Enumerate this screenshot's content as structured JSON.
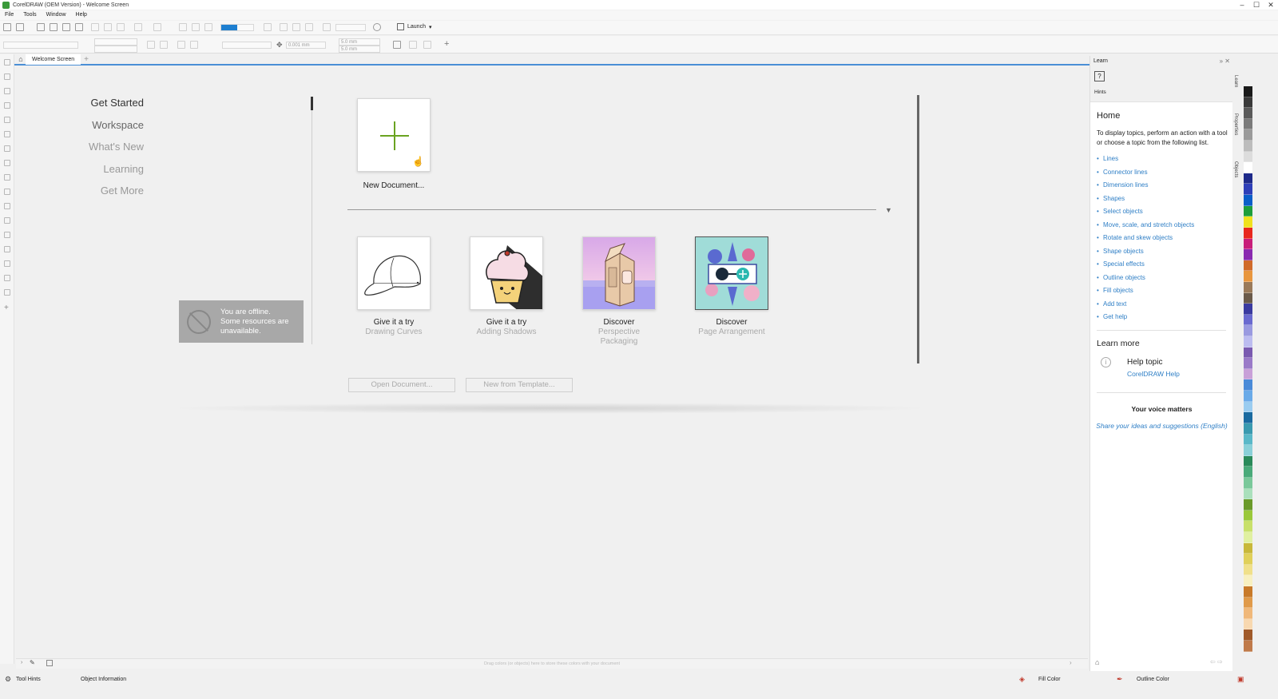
{
  "window": {
    "title": "CorelDRAW (OEM Version) - Welcome Screen",
    "controls": [
      "minimize",
      "maximize",
      "close"
    ]
  },
  "menu": [
    "File",
    "Tools",
    "Window",
    "Help"
  ],
  "toolbar": {
    "launch_label": "Launch",
    "nudge_value": "0.001 mm",
    "duplicate_x": "5.0 mm",
    "duplicate_y": "5.0 mm"
  },
  "tabs": {
    "welcome": "Welcome Screen",
    "add": "+"
  },
  "nav": [
    {
      "label": "Get Started",
      "state": "active"
    },
    {
      "label": "Workspace",
      "state": "dim"
    },
    {
      "label": "What's New",
      "state": "muted"
    },
    {
      "label": "Learning",
      "state": "muted"
    },
    {
      "label": "Get More",
      "state": "muted"
    }
  ],
  "offline": {
    "line1": "You are offline.",
    "line2": "Some resources are",
    "line3": "unavailable."
  },
  "new_document": {
    "label": "New Document..."
  },
  "cards": [
    {
      "title": "Give it a try",
      "subtitle": "Drawing Curves",
      "subtitle2": "",
      "image": "baseball-cap-icon"
    },
    {
      "title": "Give it a try",
      "subtitle": "Adding Shadows",
      "subtitle2": "",
      "image": "cupcake-icon"
    },
    {
      "title": "Discover",
      "subtitle": "Perspective",
      "subtitle2": "Packaging",
      "image": "milk-carton-icon"
    },
    {
      "title": "Discover",
      "subtitle": "Page Arrangement",
      "subtitle2": "",
      "image": "sunglasses-icon"
    }
  ],
  "buttons": {
    "open_document": "Open Document...",
    "new_from_template": "New from Template..."
  },
  "hint_bar": "Drag colors (or objects) here to store these colors with your document",
  "status": {
    "tool_hints": "Tool Hints",
    "object_info": "Object Information",
    "fill_color": "Fill Color",
    "outline_color": "Outline Color"
  },
  "learn": {
    "header": "Learn",
    "hints_label": "Hints",
    "home_title": "Home",
    "description": "To display topics, perform an action with a tool or choose a topic from the following list.",
    "topics": [
      "Lines",
      "Connector lines",
      "Dimension lines",
      "Shapes",
      "Select objects",
      "Move, scale, and stretch objects",
      "Rotate and skew objects",
      "Shape objects",
      "Special effects",
      "Outline objects",
      "Fill objects",
      "Add text",
      "Get help"
    ],
    "learn_more": "Learn more",
    "help_topic": "Help topic",
    "help_link": "CorelDRAW Help",
    "voice_title": "Your voice matters",
    "share_link": "Share your ideas and suggestions (English)"
  },
  "dockers": [
    "Learn",
    "Properties",
    "Objects"
  ],
  "palette": [
    "#1a1a1a",
    "#3a3a3a",
    "#5a5a5a",
    "#7a7a7a",
    "#9a9a9a",
    "#bcbcbc",
    "#dcdcdc",
    "#ffffff",
    "#1e2a8a",
    "#2e3fb8",
    "#0a5ec8",
    "#1e9e3a",
    "#f0e11e",
    "#e8281e",
    "#c81e7a",
    "#8a2ab0",
    "#d06a2a",
    "#e8963e",
    "#9a7a5a",
    "#6a5a4a",
    "#3a3aa0",
    "#6a6ad0",
    "#9a9ae0",
    "#bcbcf0",
    "#7a5ab0",
    "#9a7ac8",
    "#c8a0d8",
    "#4a8ad8",
    "#6aaae8",
    "#9accf0",
    "#1a6aa0",
    "#3a9ab0",
    "#5ab8c8",
    "#8ad0d8",
    "#2a8a5a",
    "#4aaa7a",
    "#7ac89a",
    "#aae0bc",
    "#6a9a2a",
    "#9ac83a",
    "#c8e06a",
    "#e0f0a0",
    "#c8b83a",
    "#e0d05a",
    "#f0e08a",
    "#f8f0c0",
    "#c87a2a",
    "#e09a4a",
    "#f0b87a",
    "#f8d8b0",
    "#a05a2a",
    "#c07a4a"
  ]
}
